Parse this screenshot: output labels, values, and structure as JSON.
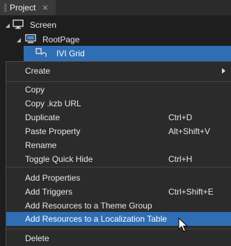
{
  "panel": {
    "tab_label": "Project",
    "close_glyph": "✕"
  },
  "tree": {
    "screen": {
      "label": "Screen",
      "icon": "screen-icon"
    },
    "rootpage": {
      "label": "RootPage",
      "icon": "page-icon"
    },
    "ivigrid": {
      "label": "IVI Grid",
      "icon": "grid-node-icon"
    }
  },
  "menu": {
    "create": "Create",
    "copy": "Copy",
    "copy_kzb": "Copy .kzb URL",
    "duplicate": {
      "label": "Duplicate",
      "shortcut": "Ctrl+D"
    },
    "paste_property": {
      "label": "Paste Property",
      "shortcut": "Alt+Shift+V"
    },
    "rename": "Rename",
    "toggle_quick_hide": {
      "label": "Toggle Quick Hide",
      "shortcut": "Ctrl+H"
    },
    "add_properties": "Add Properties",
    "add_triggers": {
      "label": "Add Triggers",
      "shortcut": "Ctrl+Shift+E"
    },
    "add_theme": "Add Resources to a Theme Group",
    "add_localization": "Add Resources to a Localization Table",
    "delete": "Delete"
  },
  "colors": {
    "selection": "#2f6eb4",
    "menu_bg": "#2b2b2b",
    "panel_bg": "#1e1e1e"
  }
}
